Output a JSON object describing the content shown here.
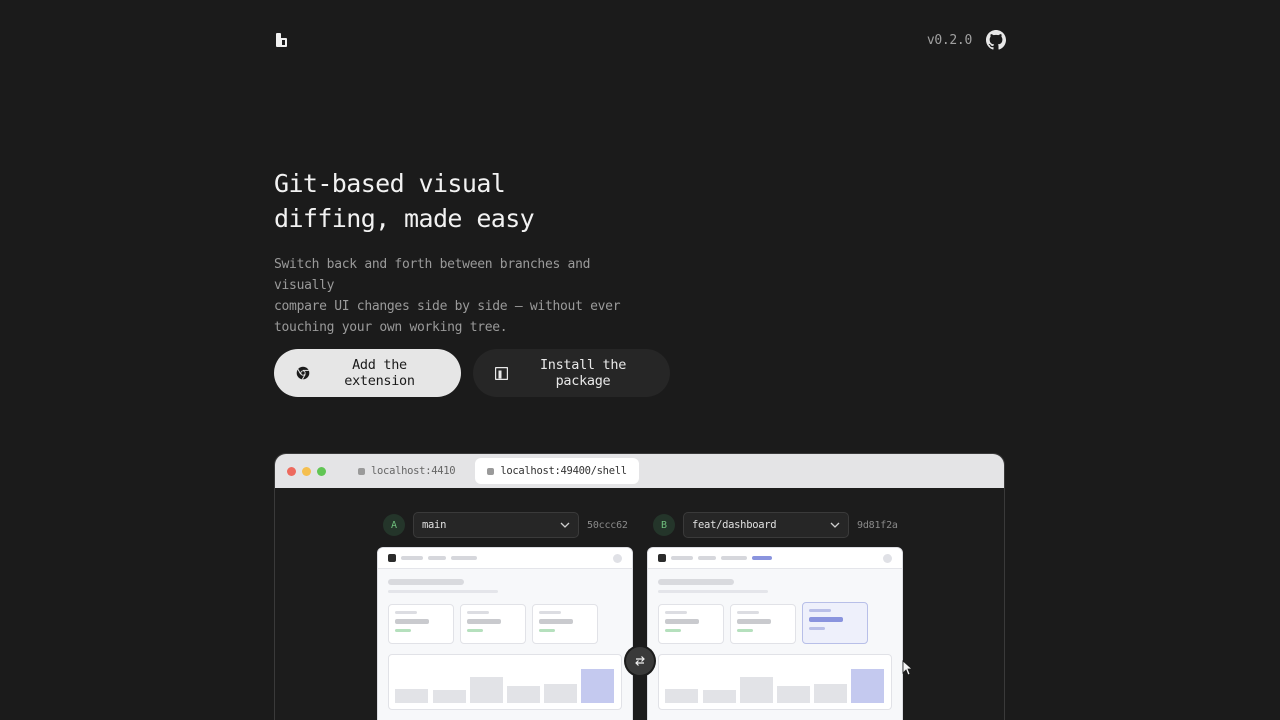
{
  "header": {
    "logo_icon": "logo-icon",
    "version": "v0.2.0",
    "github_icon": "github-icon"
  },
  "hero": {
    "title_lines": [
      "Git-based visual",
      "diffing, made easy"
    ],
    "description_lines": [
      "Switch back and forth between branches and visually",
      "compare UI changes side by side — without ever",
      "touching your own working tree."
    ]
  },
  "actions": {
    "extension_label": "Add the extension",
    "extension_icon": "chrome-icon",
    "package_label": "Install the package",
    "package_icon": "npm-icon"
  },
  "browser": {
    "tabs": [
      {
        "label": "localhost:4410",
        "active": false
      },
      {
        "label": "localhost:49400/shell",
        "active": true
      }
    ],
    "traffic_colors": [
      "#ed6a5e",
      "#f5bf4f",
      "#61c554"
    ],
    "left": {
      "badge": "A",
      "branch": "main",
      "sha": "50ccc62"
    },
    "right": {
      "badge": "B",
      "branch": "feat/dashboard",
      "sha": "9d81f2a"
    },
    "swap_icon": "swap-icon"
  }
}
